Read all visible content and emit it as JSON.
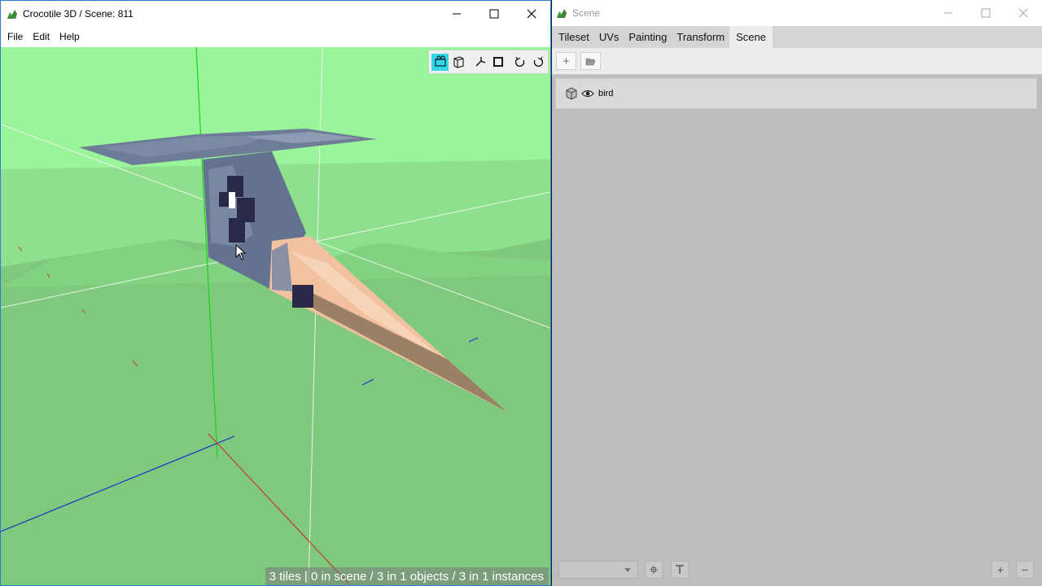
{
  "left_window": {
    "title": "Crocotile 3D / Scene: 811",
    "menu": [
      "File",
      "Edit",
      "Help"
    ],
    "icons": [
      "app-icon",
      "minimize-icon",
      "maximize-icon",
      "close-icon"
    ],
    "viewport_toolbar": [
      "camera-mode-icon",
      "perspective-cube-icon",
      "axis-gizmo-icon",
      "square-select-icon",
      "undo-icon",
      "redo-icon"
    ],
    "status": "3 tiles | 0 in scene / 3 in 1 objects / 3 in 1 instances",
    "colors": {
      "sky": "#9af59a",
      "ground": "#7ec97e",
      "toolbar_active": "#33d6e6"
    }
  },
  "right_window": {
    "title": "Scene",
    "tabs": [
      "Tileset",
      "UVs",
      "Painting",
      "Transform",
      "Scene"
    ],
    "active_tab": "Scene",
    "toolbar": [
      {
        "icon": "add-icon",
        "label": "+"
      },
      {
        "icon": "folder-open-icon",
        "label": ""
      }
    ],
    "objects": [
      {
        "name": "bird",
        "icons": [
          "cube-icon",
          "eye-icon"
        ]
      }
    ],
    "bottom": {
      "select_value": "",
      "buttons": [
        "crosshair-icon",
        "text-icon",
        "add-icon",
        "remove-icon"
      ],
      "add_label": "+",
      "remove_label": "−"
    }
  }
}
